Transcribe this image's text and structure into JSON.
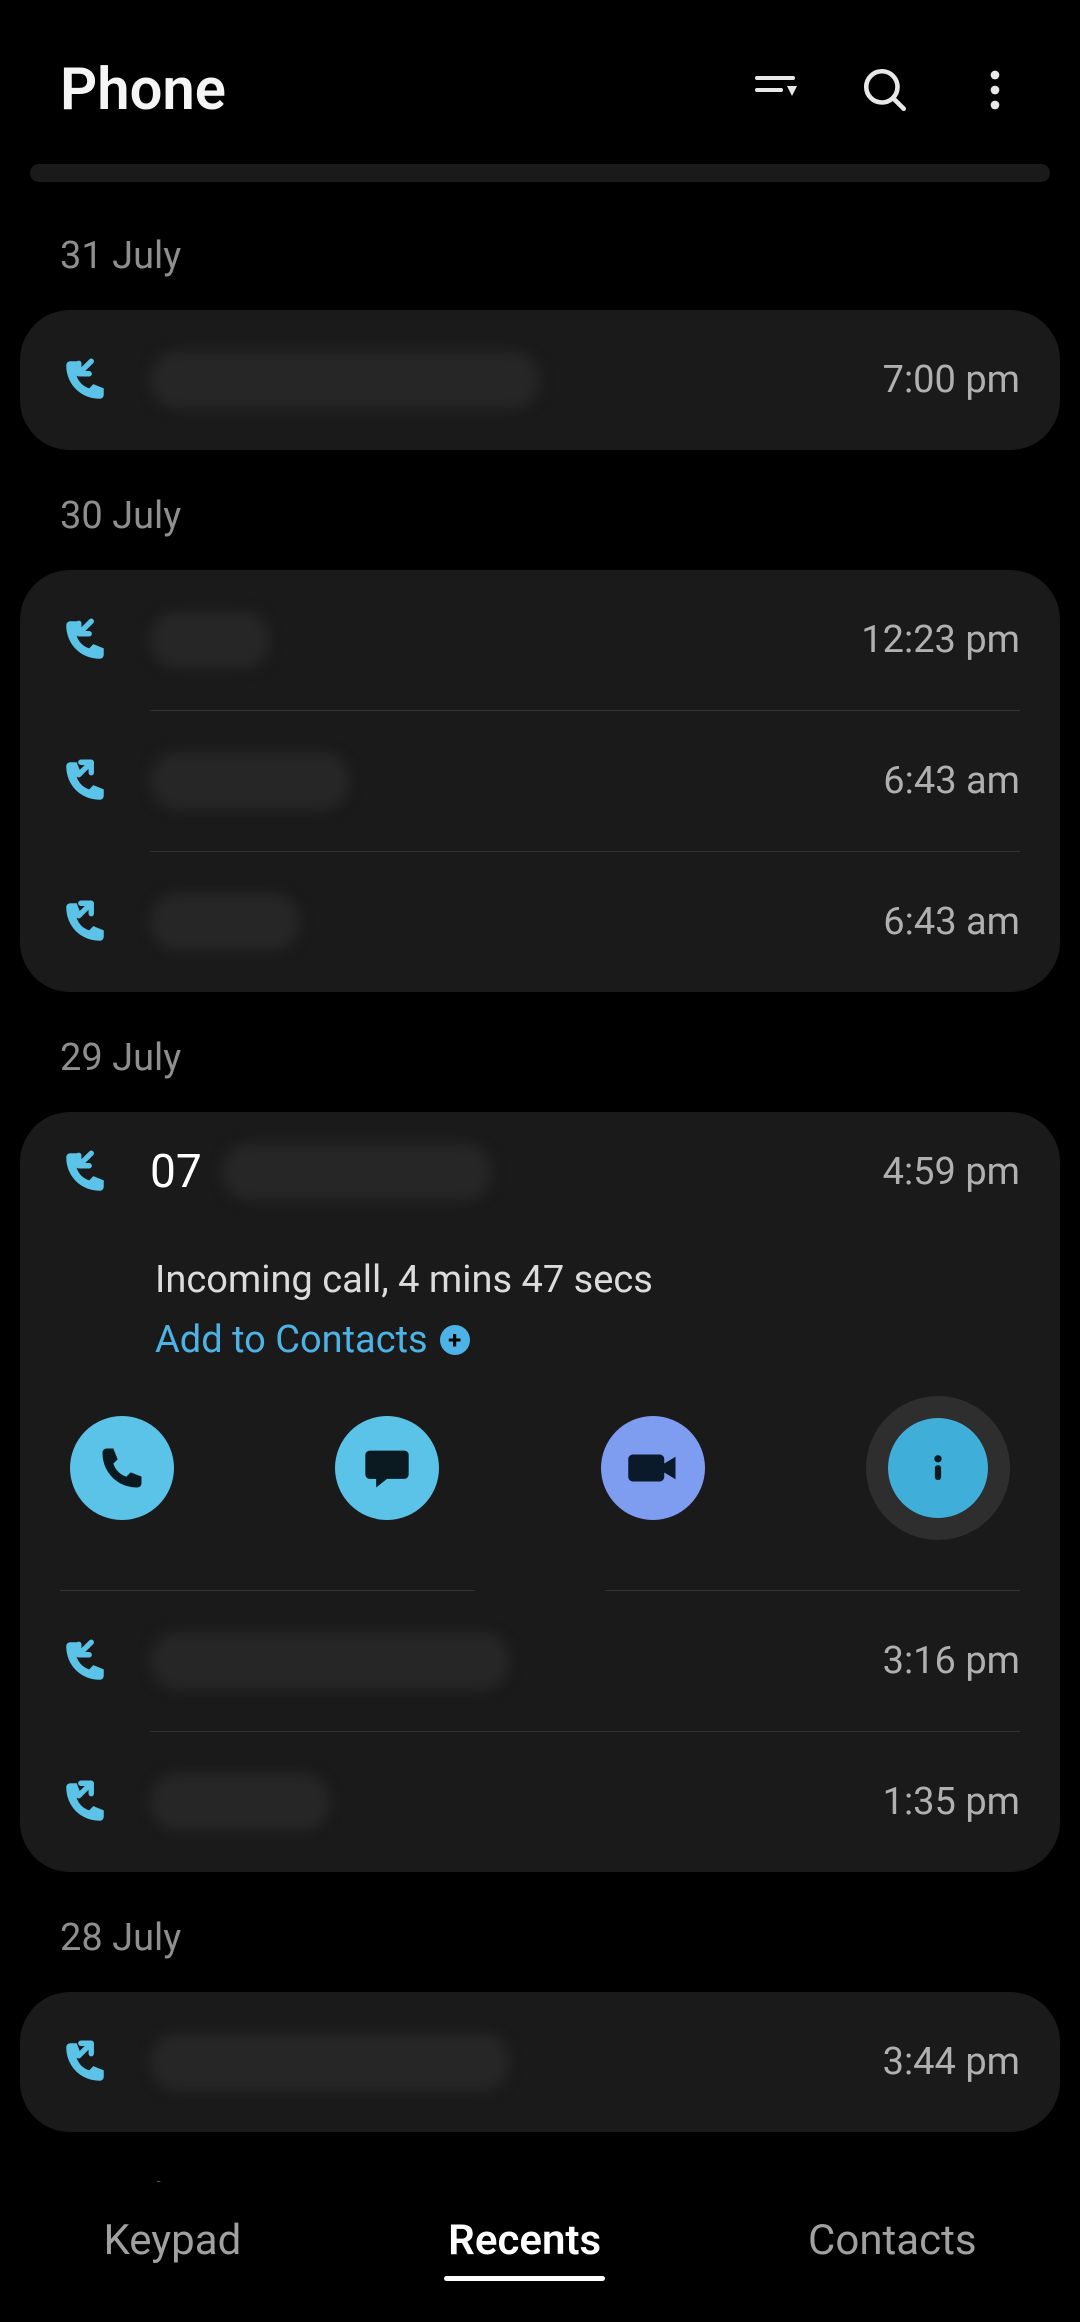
{
  "header": {
    "title": "Phone",
    "filter_icon": "filter-icon",
    "search_icon": "search-icon",
    "menu_icon": "more-icon"
  },
  "colors": {
    "accent": "#5bc3e8",
    "video": "#7e9cf0",
    "info": "#3faed9",
    "text_muted": "#8e8e8e"
  },
  "groups": [
    {
      "date": "31 July",
      "entries": [
        {
          "type": "incoming",
          "name_redacted": true,
          "redact_width": 390,
          "time": "7:00 pm"
        }
      ]
    },
    {
      "date": "30 July",
      "entries": [
        {
          "type": "incoming",
          "name_redacted": true,
          "redact_width": 120,
          "time": "12:23 pm"
        },
        {
          "type": "outgoing",
          "name_redacted": true,
          "redact_width": 200,
          "time": "6:43 am"
        },
        {
          "type": "outgoing",
          "name_redacted": true,
          "redact_width": 150,
          "time": "6:43 am"
        }
      ]
    },
    {
      "date": "29 July",
      "entries": [
        {
          "type": "incoming",
          "expanded": true,
          "name_prefix": "07",
          "name_redacted": true,
          "redact_width": 270,
          "time": "4:59 pm",
          "detail": "Incoming call, 4 mins 47 secs",
          "add_contacts_label": "Add to Contacts"
        },
        {
          "type": "incoming",
          "name_redacted": true,
          "redact_width": 360,
          "time": "3:16 pm"
        },
        {
          "type": "outgoing",
          "name_redacted": true,
          "redact_width": 180,
          "time": "1:35 pm"
        }
      ]
    },
    {
      "date": "28 July",
      "entries": [
        {
          "type": "outgoing",
          "name_redacted": true,
          "redact_width": 360,
          "time": "3:44 pm"
        }
      ]
    },
    {
      "date": "27 July",
      "entries": []
    }
  ],
  "nav": {
    "items": [
      "Keypad",
      "Recents",
      "Contacts"
    ],
    "active_index": 1
  }
}
